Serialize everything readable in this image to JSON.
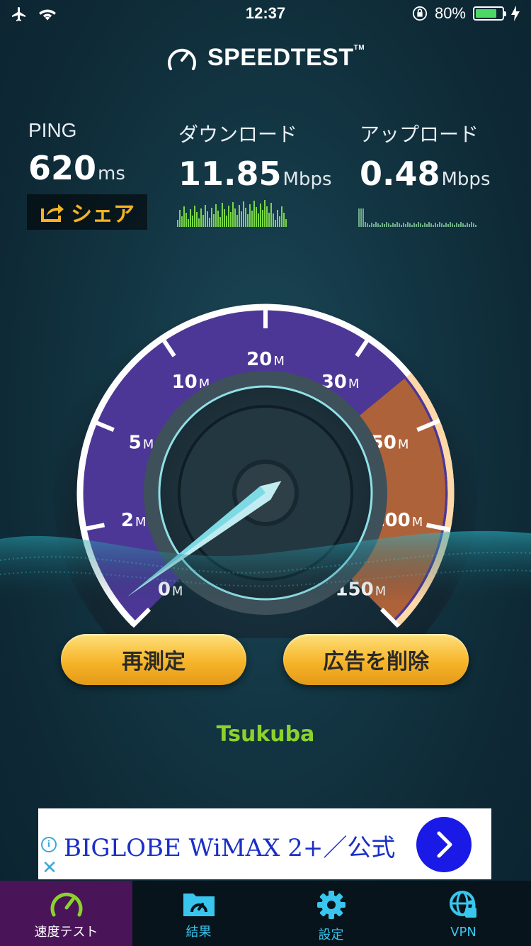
{
  "status_bar": {
    "time": "12:37",
    "battery_text": "80%",
    "battery_level": 0.8
  },
  "header": {
    "logo_text": "SPEEDTEST",
    "trademark": "TM"
  },
  "results": {
    "ping": {
      "label": "PING",
      "value": "620",
      "unit": "ms"
    },
    "download": {
      "label": "ダウンロード",
      "value": "11.85",
      "unit": "Mbps"
    },
    "upload": {
      "label": "アップロード",
      "value": "0.48",
      "unit": "Mbps"
    }
  },
  "share_button": {
    "label": "シェア"
  },
  "gauge": {
    "ticks": [
      {
        "num": "0",
        "unit": "M"
      },
      {
        "num": "2",
        "unit": "M"
      },
      {
        "num": "5",
        "unit": "M"
      },
      {
        "num": "10",
        "unit": "M"
      },
      {
        "num": "20",
        "unit": "M"
      },
      {
        "num": "30",
        "unit": "M"
      },
      {
        "num": "50",
        "unit": "M"
      },
      {
        "num": "100",
        "unit": "M"
      },
      {
        "num": "150",
        "unit": "M"
      }
    ],
    "needle_value": 0.48
  },
  "buttons": {
    "retest": "再測定",
    "remove_ads": "広告を削除"
  },
  "server_name": "Tsukuba",
  "ad": {
    "title": "BIGLOBE WiMAX 2+／公式"
  },
  "tab_bar": {
    "items": [
      {
        "label": "速度テスト",
        "active": true
      },
      {
        "label": "結果",
        "active": false
      },
      {
        "label": "設定",
        "active": false
      },
      {
        "label": "VPN",
        "active": false
      }
    ]
  },
  "colors": {
    "accent_gold": "#f4b321",
    "server_green": "#8bd32b",
    "tab_blue": "#39c6ee",
    "active_tab": "#4a1458"
  }
}
